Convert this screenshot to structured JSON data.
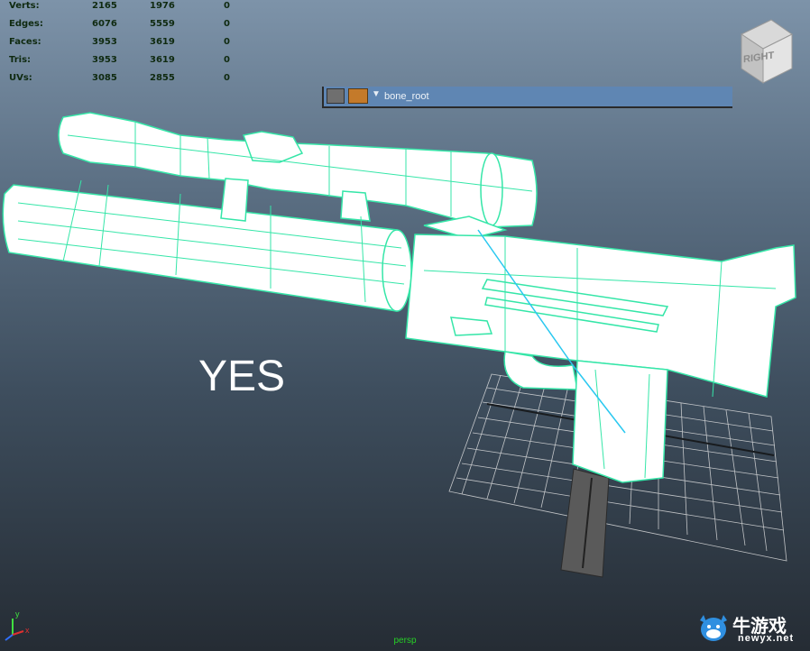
{
  "hud": {
    "rows": [
      {
        "label": "Verts:",
        "v1": "2165",
        "v2": "1976",
        "v3": "0"
      },
      {
        "label": "Edges:",
        "v1": "6076",
        "v2": "5559",
        "v3": "0"
      },
      {
        "label": "Faces:",
        "v1": "3953",
        "v2": "3619",
        "v3": "0"
      },
      {
        "label": "Tris:",
        "v1": "3953",
        "v2": "3619",
        "v3": "0"
      },
      {
        "label": "UVs:",
        "v1": "3085",
        "v2": "2855",
        "v3": "0"
      }
    ]
  },
  "outliner": {
    "node_name": "bone_root"
  },
  "viewcube": {
    "face_label": "RIGHT"
  },
  "overlay_text": "YES",
  "camera_label": "persp",
  "axis": {
    "y_label": "y",
    "x_label": "x"
  },
  "watermark": {
    "site_cn": "牛游戏",
    "url": "newyx.net"
  },
  "colors": {
    "wireframe": "#35e6a8",
    "highlight": "#2ac8f0",
    "grid": "#e6e6e6",
    "hud_text": "#0f2a10",
    "camera_label": "#26d026"
  }
}
